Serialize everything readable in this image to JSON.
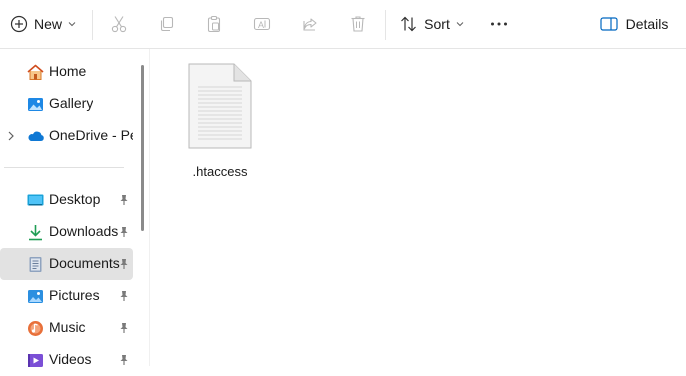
{
  "toolbar": {
    "new_label": "New",
    "sort_label": "Sort",
    "details_label": "Details",
    "buttons": [
      "plus-circle-icon",
      "cut-icon",
      "copy-icon",
      "paste-icon",
      "rename-icon",
      "share-icon",
      "delete-icon",
      "sort-icon",
      "more-icon",
      "details-pane-icon"
    ]
  },
  "sidebar": {
    "items": [
      {
        "label": "Home",
        "icon": "home-icon",
        "pinned": false
      },
      {
        "label": "Gallery",
        "icon": "gallery-icon",
        "pinned": false
      },
      {
        "label": "OneDrive - Per",
        "icon": "onedrive-icon",
        "pinned": false,
        "expandable": true
      },
      {
        "label": "Desktop",
        "icon": "desktop-icon",
        "pinned": true
      },
      {
        "label": "Downloads",
        "icon": "downloads-icon",
        "pinned": true
      },
      {
        "label": "Documents",
        "icon": "documents-icon",
        "pinned": true,
        "selected": true
      },
      {
        "label": "Pictures",
        "icon": "pictures-icon",
        "pinned": true
      },
      {
        "label": "Music",
        "icon": "music-icon",
        "pinned": true
      },
      {
        "label": "Videos",
        "icon": "videos-icon",
        "pinned": true
      }
    ]
  },
  "files": [
    {
      "name": ".htaccess",
      "icon": "generic-file-icon"
    }
  ],
  "colors": {
    "accent": "#0067c0",
    "selected_bg": "#e2e2e2",
    "toolbar_disabled": "#b8b8b8"
  }
}
